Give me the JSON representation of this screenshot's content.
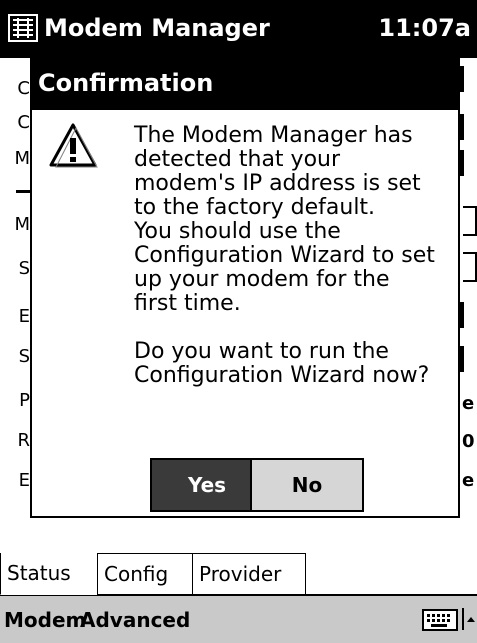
{
  "titlebar": {
    "app_title": "Modem Manager",
    "clock": "11:07a"
  },
  "background": {
    "left_letters": [
      "C",
      "C",
      "M",
      "M",
      "S",
      "E",
      "S",
      "P",
      "R",
      "E"
    ],
    "right_fragments": [
      "e",
      "0",
      "e"
    ]
  },
  "dialog": {
    "title": "Confirmation",
    "icon": "warning-exclamation-icon",
    "message": "The Modem Manager has\ndetected that your\nmodem's IP address is set\nto the factory default.\nYou should use the\nConfiguration Wizard to set\nup your modem for the\nfirst time.\n\nDo you want to run the\nConfiguration Wizard now?",
    "yes_label": "Yes",
    "no_label": "No"
  },
  "tabs": [
    {
      "label": "Status",
      "active": true
    },
    {
      "label": "Config",
      "active": false
    },
    {
      "label": "Provider",
      "active": false
    }
  ],
  "menubar": {
    "modem_label": "Modem",
    "advanced_label": "Advanced",
    "keyboard_icon": "keyboard-icon",
    "sip_icon": "up-arrow-icon"
  }
}
